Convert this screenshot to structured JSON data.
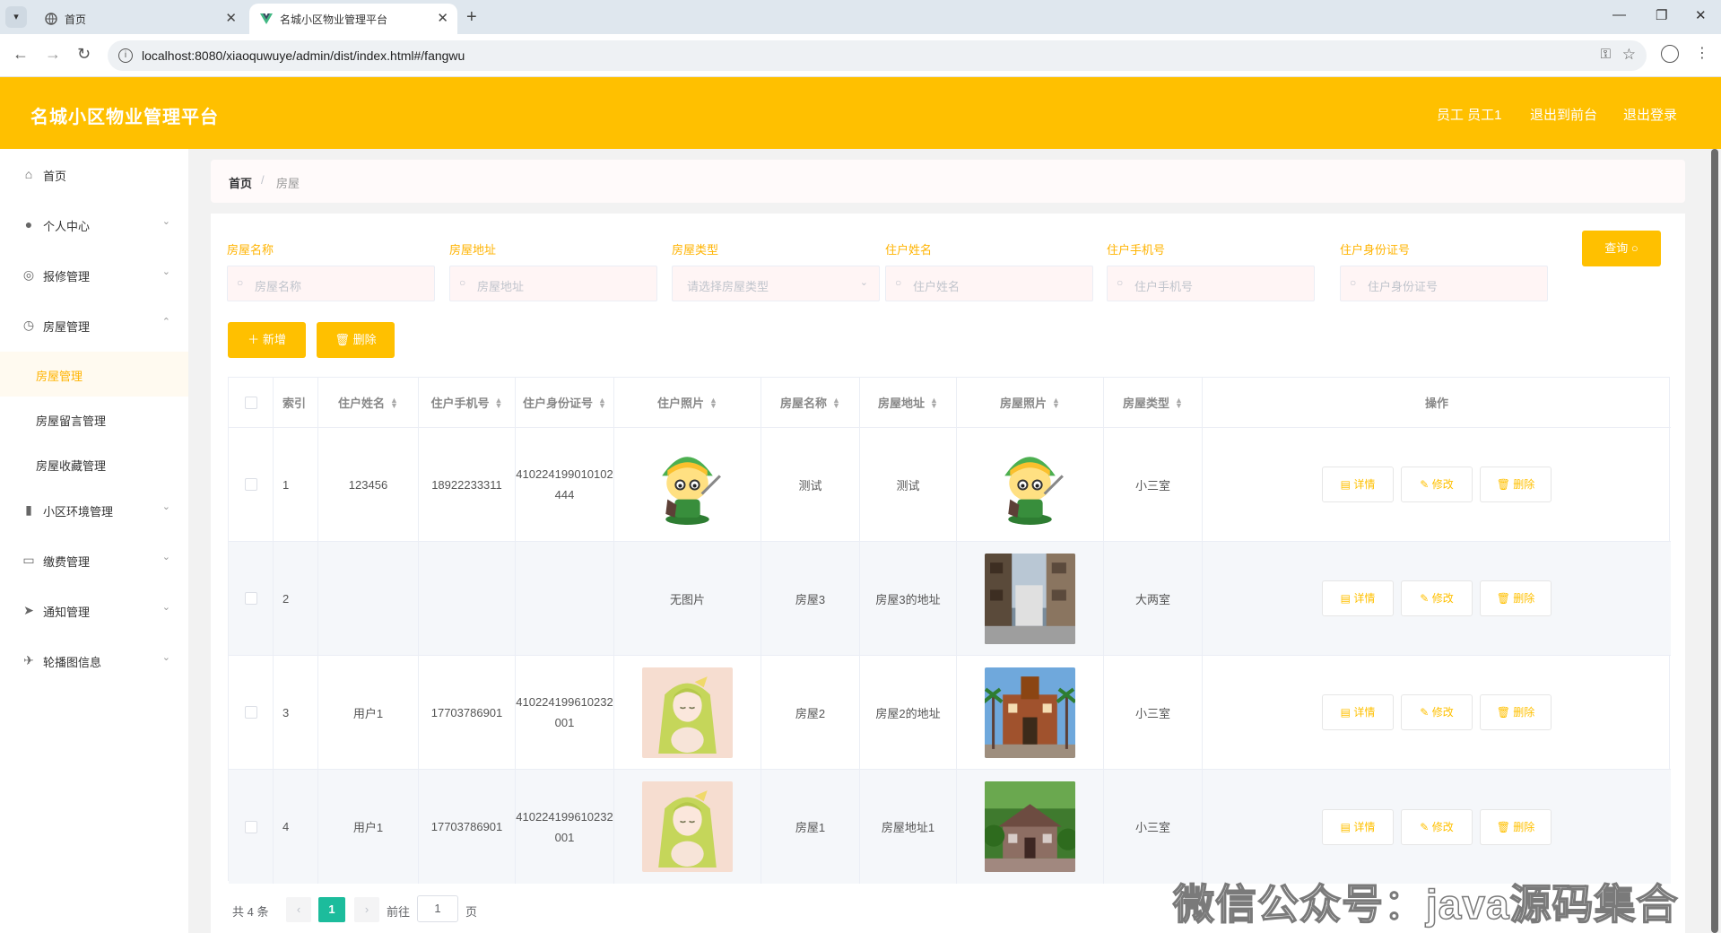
{
  "browser": {
    "tabs": [
      {
        "title": "首页",
        "active": false
      },
      {
        "title": "名城小区物业管理平台",
        "active": true
      }
    ],
    "url": "localhost:8080/xiaoquwuye/admin/dist/index.html#/fangwu"
  },
  "header": {
    "title": "名城小区物业管理平台",
    "links": [
      "员工 员工1",
      "退出到前台",
      "退出登录"
    ],
    "color": "#ffc000"
  },
  "sidebar": {
    "items": [
      {
        "label": "首页",
        "icon": "home-icon"
      },
      {
        "label": "个人中心",
        "icon": "user-icon"
      },
      {
        "label": "报修管理",
        "icon": "settings-icon"
      },
      {
        "label": "房屋管理",
        "icon": "compass-icon"
      },
      {
        "label": "小区环境管理",
        "icon": "bar-chart-icon"
      },
      {
        "label": "缴费管理",
        "icon": "chat-icon"
      },
      {
        "label": "通知管理",
        "icon": "send-icon"
      },
      {
        "label": "轮播图信息",
        "icon": "plane-icon"
      }
    ],
    "sub_items": [
      "房屋管理",
      "房屋留言管理",
      "房屋收藏管理"
    ]
  },
  "breadcrumb": {
    "home": "首页",
    "sep": "/",
    "current": "房屋"
  },
  "filters": {
    "fields": [
      {
        "label": "房屋名称",
        "placeholder": "房屋名称"
      },
      {
        "label": "房屋地址",
        "placeholder": "房屋地址"
      },
      {
        "label": "房屋类型",
        "placeholder": "请选择房屋类型"
      },
      {
        "label": "住户姓名",
        "placeholder": "住户姓名"
      },
      {
        "label": "住户手机号",
        "placeholder": "住户手机号"
      },
      {
        "label": "住户身份证号",
        "placeholder": "住户身份证号"
      }
    ],
    "query_label": "查询",
    "add_label": "新增",
    "delete_label": "删除"
  },
  "table": {
    "headers": [
      "索引",
      "住户姓名",
      "住户手机号",
      "住户身份证号",
      "住户照片",
      "房屋名称",
      "房屋地址",
      "房屋照片",
      "房屋类型",
      "操作"
    ],
    "rows": [
      {
        "index": "1",
        "name": "123456",
        "phone": "18922233311",
        "id_card": "410224199010102444",
        "photo": "avatar-ninja",
        "house_name": "测试",
        "address": "测试",
        "house_photo": "avatar-ninja",
        "type": "小三室"
      },
      {
        "index": "2",
        "name": "",
        "phone": "",
        "id_card": "",
        "photo": "none",
        "photo_text": "无图片",
        "house_name": "房屋3",
        "address": "房屋3的地址",
        "house_photo": "house-street",
        "type": "大两室"
      },
      {
        "index": "3",
        "name": "用户1",
        "phone": "17703786901",
        "id_card": "410224199610232001",
        "photo": "anime-girl",
        "house_name": "房屋2",
        "address": "房屋2的地址",
        "house_photo": "house-palms",
        "type": "小三室"
      },
      {
        "index": "4",
        "name": "用户1",
        "phone": "17703786901",
        "id_card": "410224199610232001",
        "photo": "anime-girl",
        "house_name": "房屋1",
        "address": "房屋地址1",
        "house_photo": "house-garden",
        "type": "小三室"
      }
    ],
    "actions": [
      "详情",
      "修改",
      "删除"
    ]
  },
  "pagination": {
    "total": "共 4 条",
    "current": "1",
    "goto_prefix": "前往",
    "goto_value": "1",
    "goto_suffix": "页"
  },
  "watermark": "微信公众号：java源码集合"
}
